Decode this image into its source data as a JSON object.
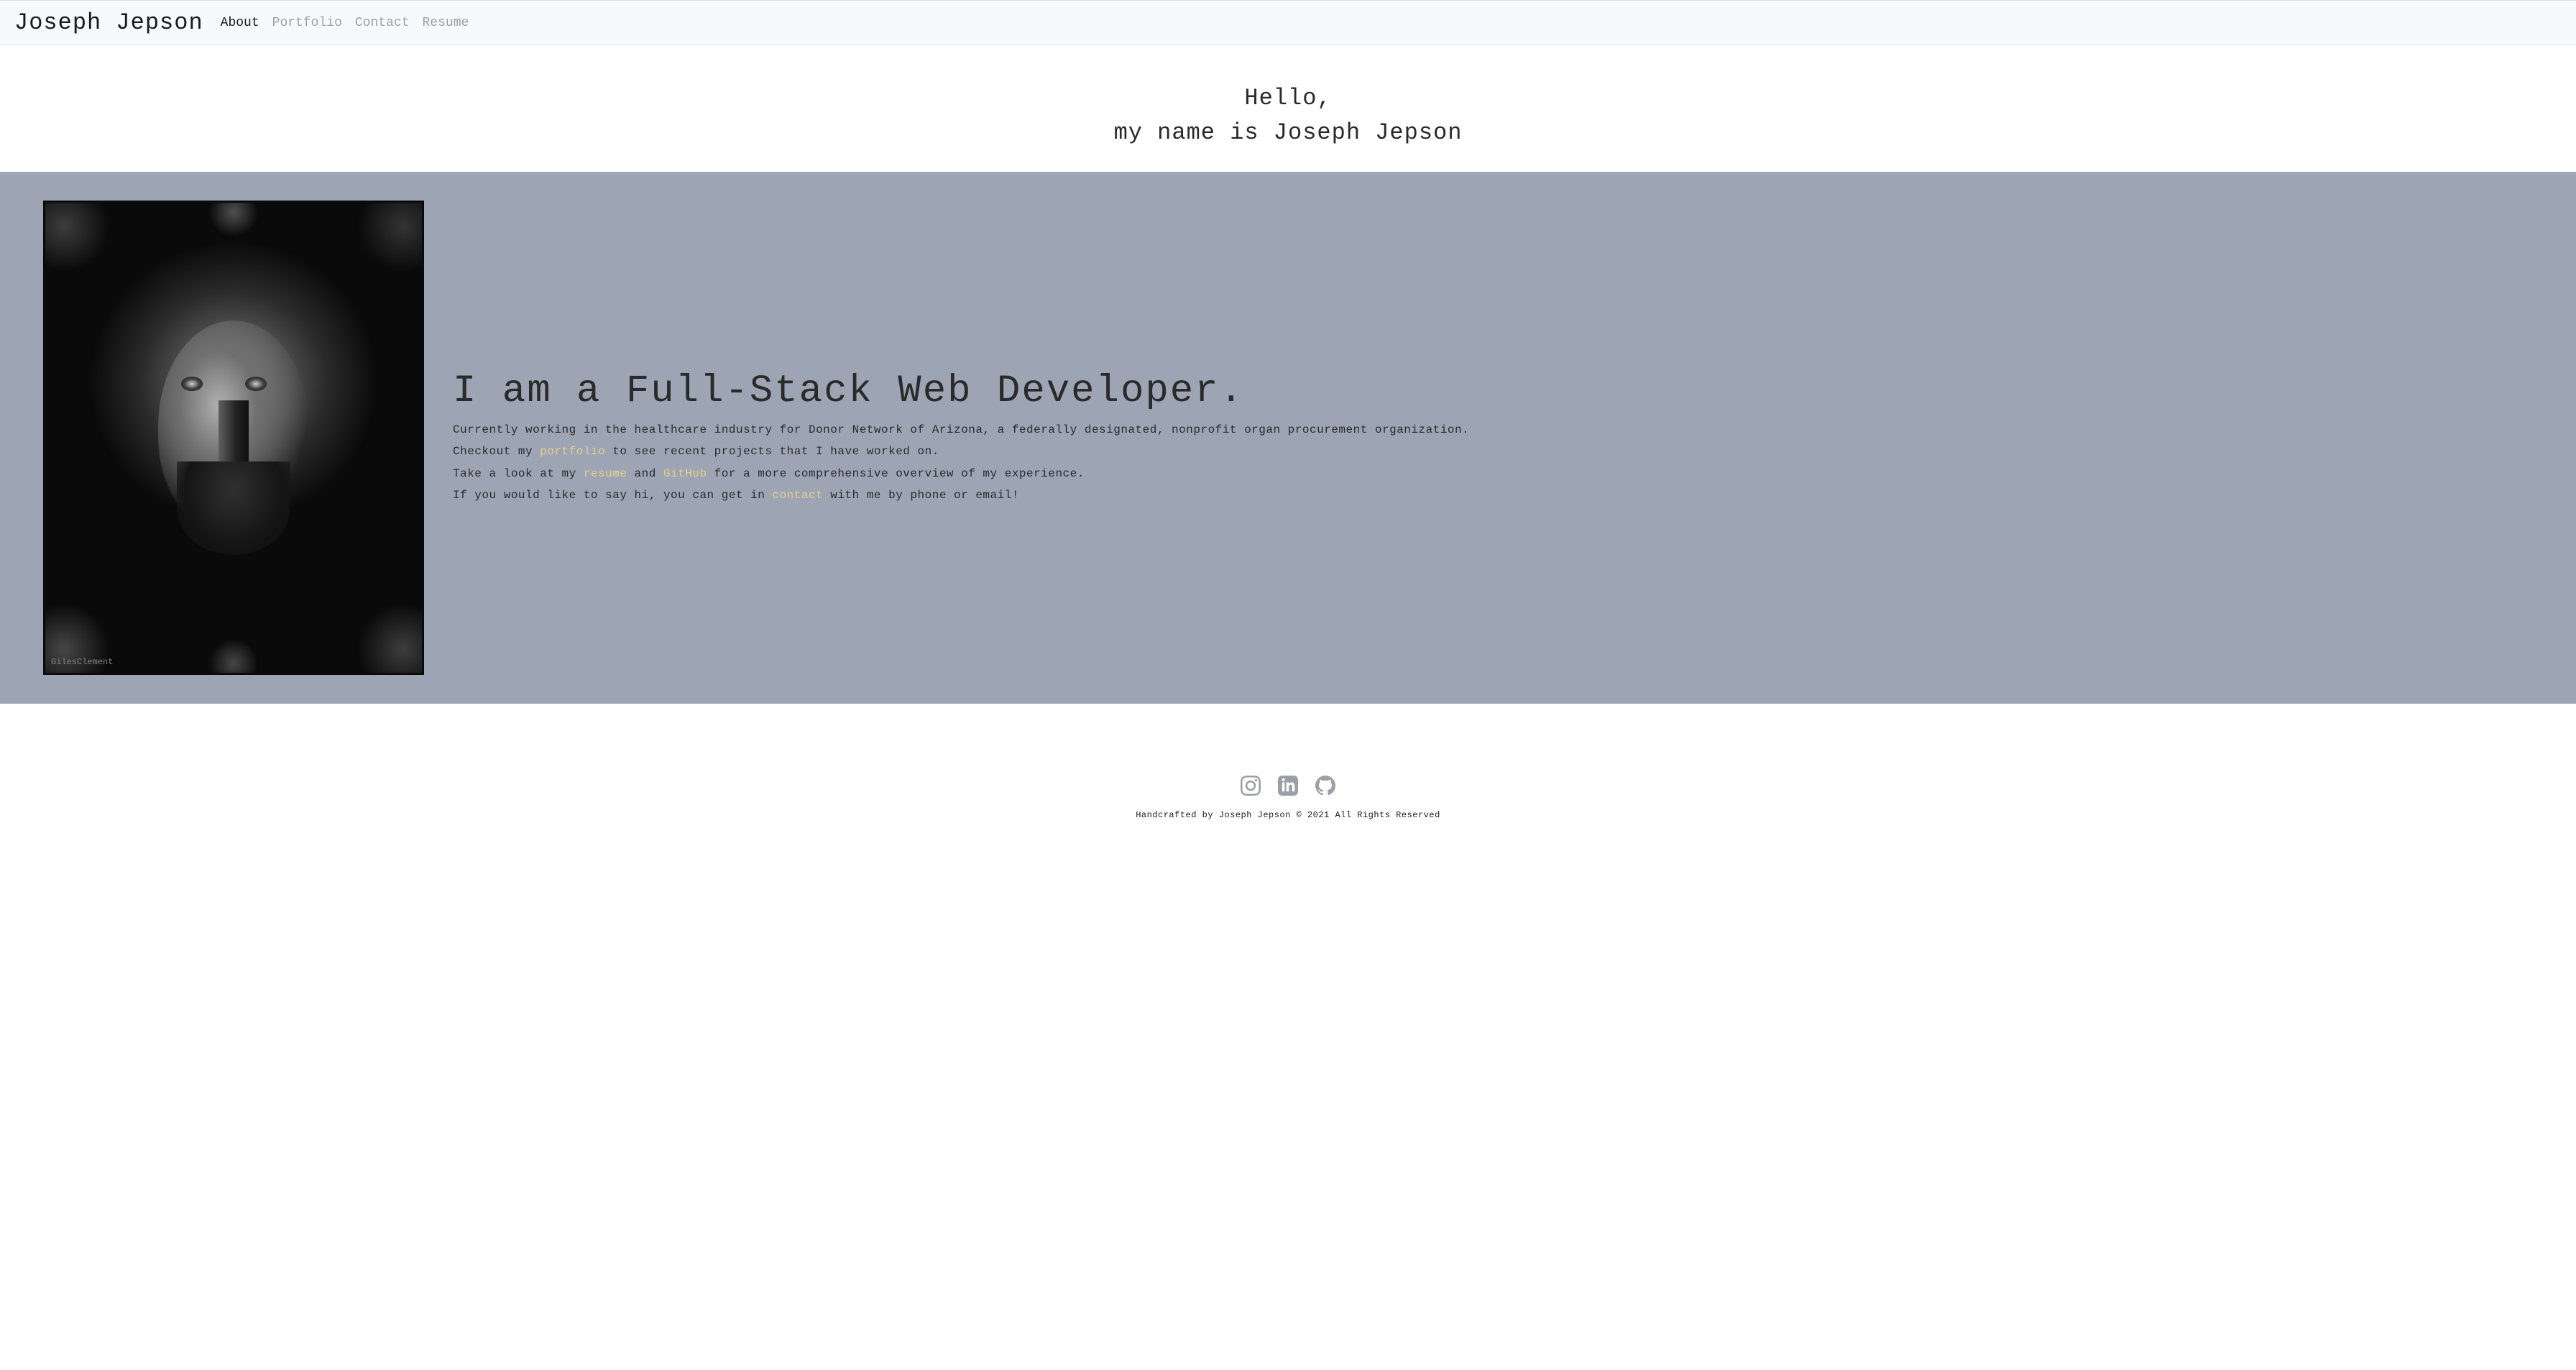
{
  "navbar": {
    "brand": "Joseph Jepson",
    "links": [
      {
        "label": "About",
        "active": true
      },
      {
        "label": "Portfolio",
        "active": false
      },
      {
        "label": "Contact",
        "active": false
      },
      {
        "label": "Resume",
        "active": false
      }
    ]
  },
  "hero": {
    "line1": "Hello,",
    "line2": "my name is Joseph Jepson"
  },
  "main": {
    "headline": "I am a Full-Stack Web Developer.",
    "para1": "Currently working in the healthcare industry for Donor Network of Arizona, a federally designated, nonprofit organ procurement organization.",
    "para2_pre": "Checkout my ",
    "para2_link": "portfolio",
    "para2_post": " to see recent projects that I have worked on.",
    "para3_pre": "Take a look at my ",
    "para3_link1": "resume",
    "para3_mid": " and ",
    "para3_link2": "GitHub",
    "para3_post": " for a more comprehensive overview of my experience.",
    "para4_pre": "If you would like to say hi, you can get in ",
    "para4_link": "contact",
    "para4_post": " with me by phone or email!",
    "watermark": "GilesClement"
  },
  "footer": {
    "text": "Handcrafted by Joseph Jepson © 2021 All Rights Reserved",
    "social": [
      "instagram",
      "linkedin",
      "github"
    ]
  }
}
